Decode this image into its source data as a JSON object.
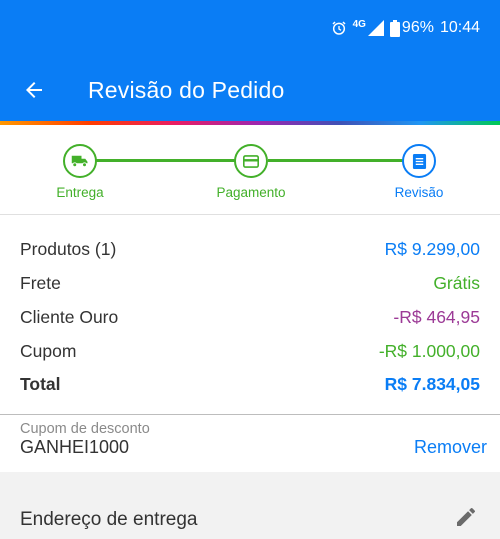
{
  "status_bar": {
    "network": "4G",
    "battery": "96%",
    "time": "10:44",
    "alarm_icon": "alarm-icon",
    "signal_icon": "signal-icon",
    "battery_icon": "battery-icon"
  },
  "header": {
    "title": "Revisão do Pedido",
    "back_icon": "arrow-left-icon"
  },
  "stepper": {
    "steps": [
      {
        "label": "Entrega",
        "icon": "truck-icon",
        "state": "done",
        "color": "#43b02a"
      },
      {
        "label": "Pagamento",
        "icon": "card-icon",
        "state": "done",
        "color": "#43b02a"
      },
      {
        "label": "Revisão",
        "icon": "document-icon",
        "state": "current",
        "color": "#0a7df5"
      }
    ]
  },
  "summary": {
    "rows": [
      {
        "label": "Produtos (1)",
        "value": "R$ 9.299,00",
        "color": "#0a7df5"
      },
      {
        "label": "Frete",
        "value": "Grátis",
        "color": "#43b02a"
      },
      {
        "label": "Cliente Ouro",
        "value": "-R$ 464,95",
        "color": "#9c3a96"
      },
      {
        "label": "Cupom",
        "value": "-R$ 1.000,00",
        "color": "#43b02a"
      },
      {
        "label": "Total",
        "value": "R$ 7.834,05",
        "color": "#0a7df5"
      }
    ]
  },
  "coupon": {
    "caption": "Cupom de desconto",
    "code": "GANHEI1000",
    "remove_label": "Remover"
  },
  "address": {
    "title": "Endereço de entrega",
    "edit_icon": "pencil-icon"
  },
  "colors": {
    "primary": "#0a7df5",
    "success": "#43b02a",
    "discount": "#9c3a96"
  }
}
